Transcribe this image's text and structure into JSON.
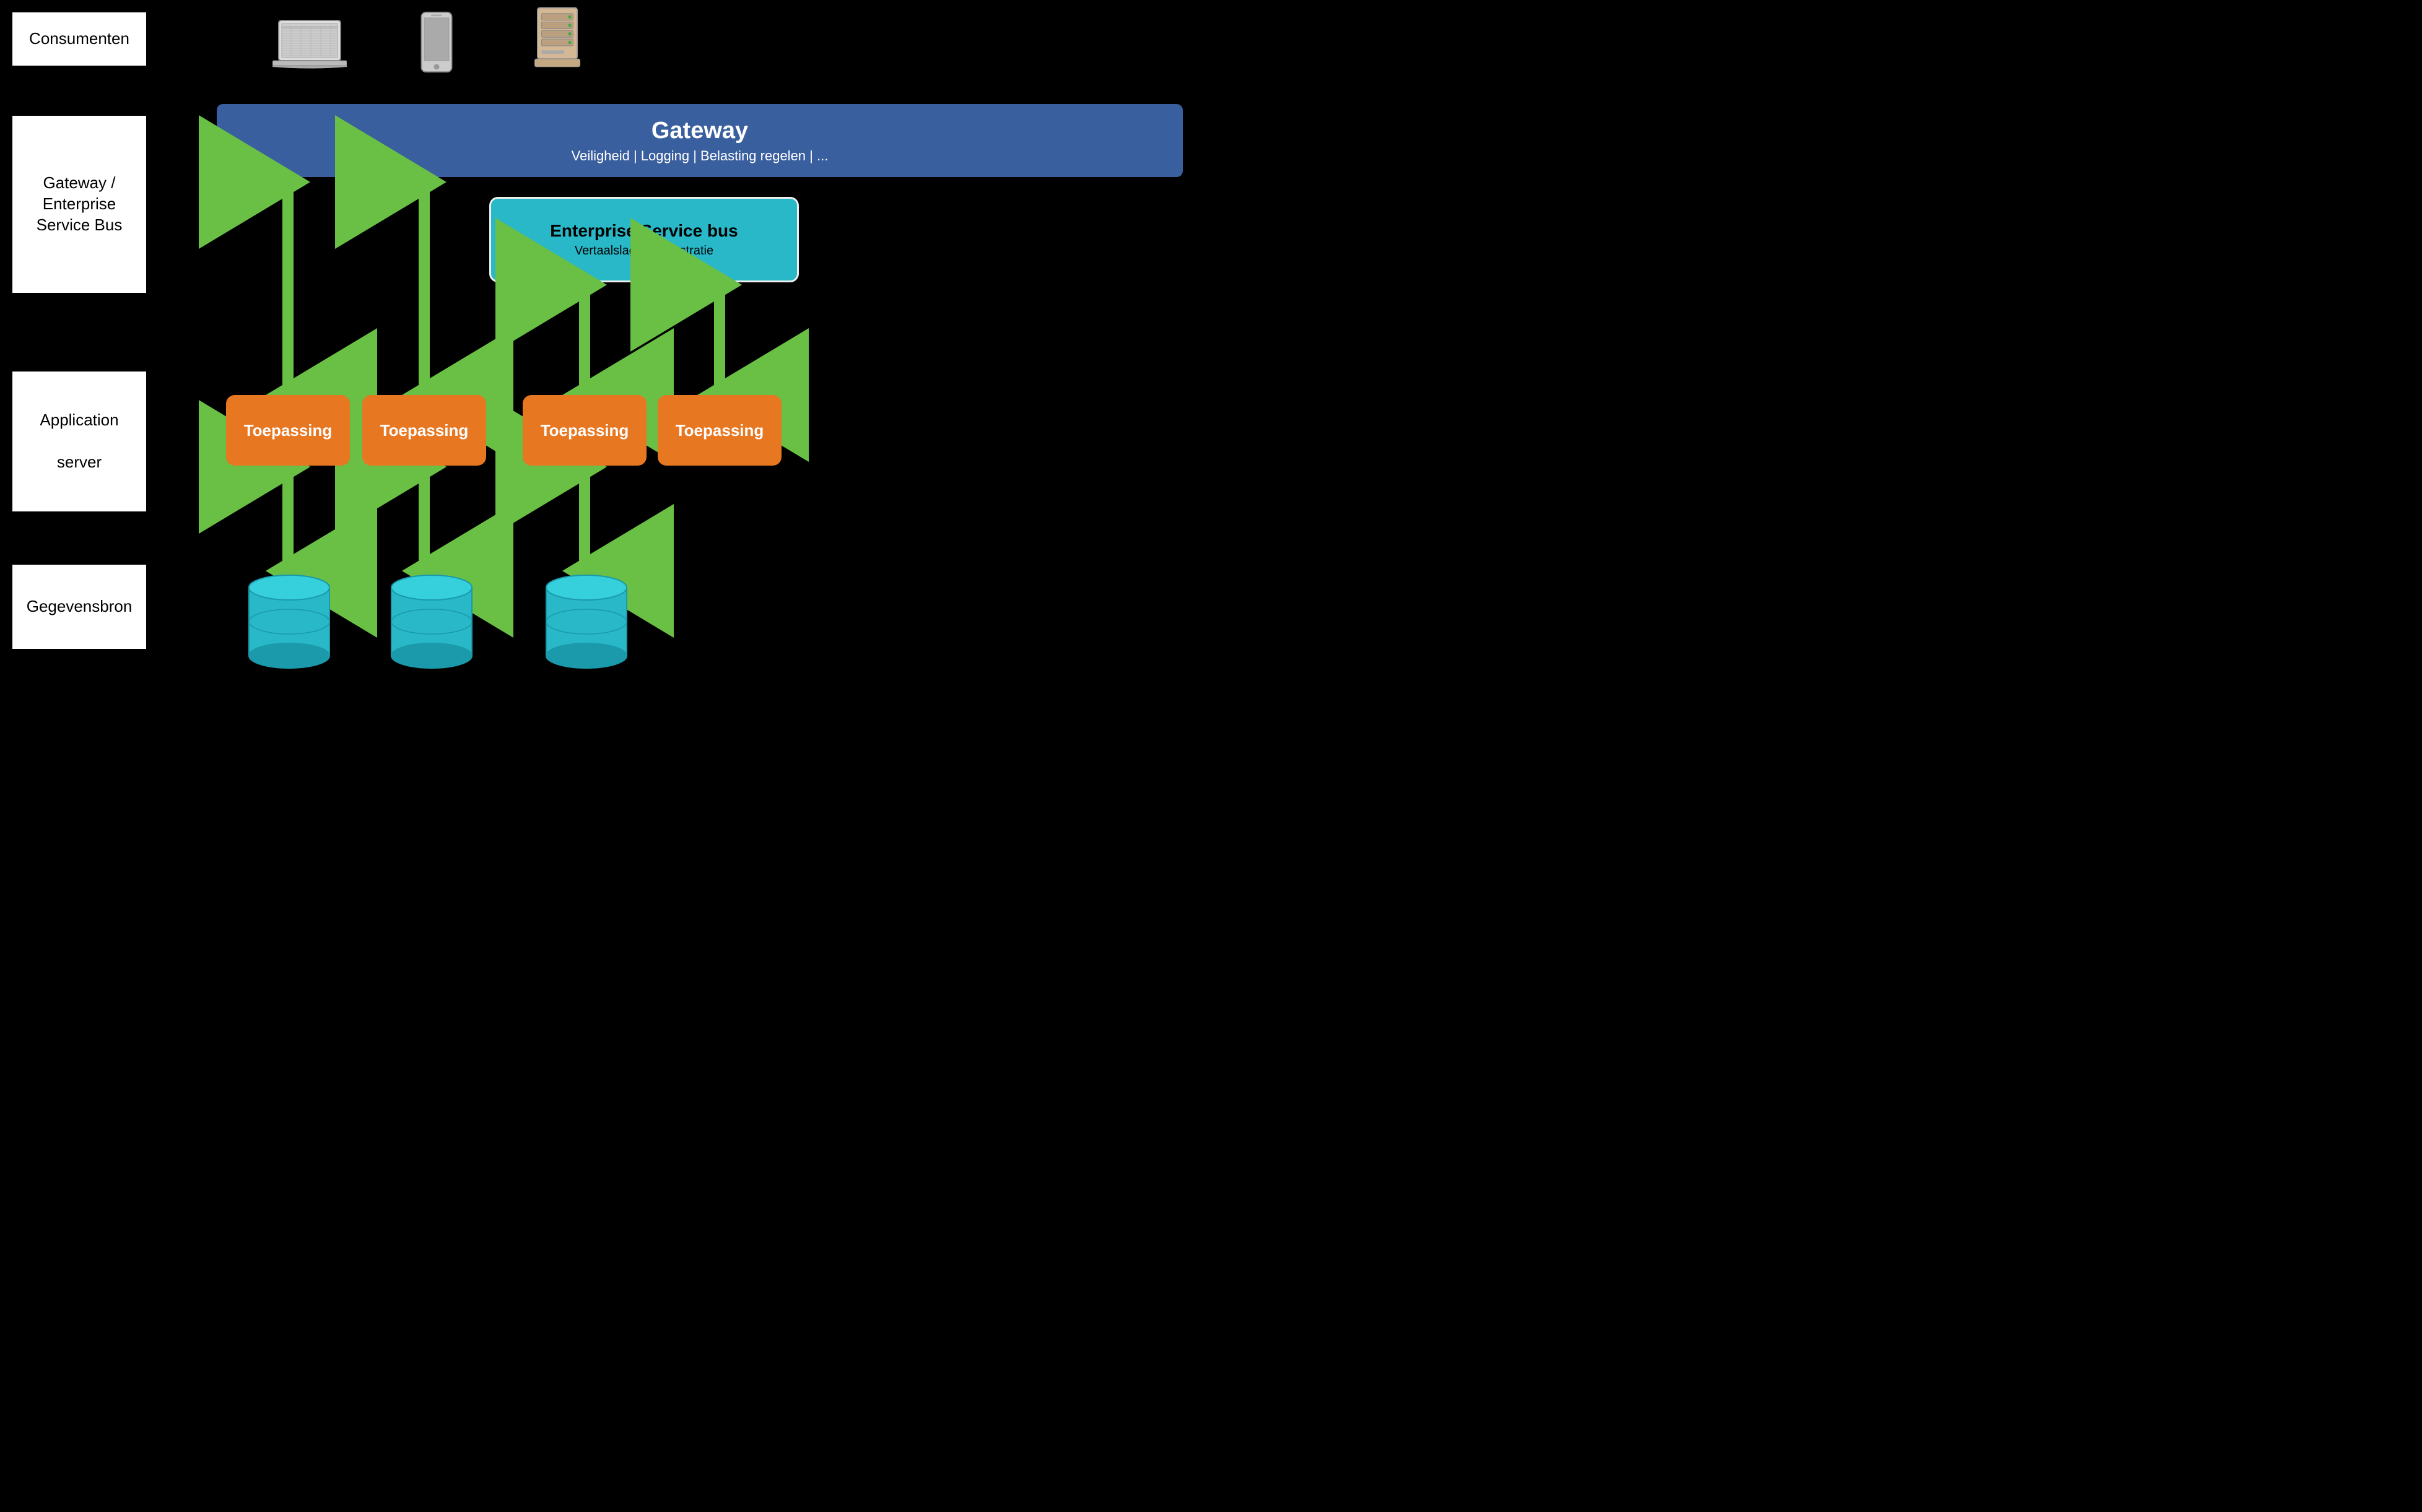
{
  "labels": {
    "consumenten": "Consumenten",
    "gateway_esb": "Gateway /\nEnterprise\nService Bus",
    "application_server": "Application\nserver",
    "gegevensbron": "Gegevensbron"
  },
  "consumers": [
    {
      "id": "browser",
      "label": "BROWSER"
    },
    {
      "id": "mobile",
      "label": "MOBILE"
    },
    {
      "id": "b2b",
      "label": "B2B"
    }
  ],
  "gateway": {
    "title": "Gateway",
    "subtitle": "Veiligheid | Logging | Belasting regelen | ..."
  },
  "esb": {
    "title": "Enterprise Service bus",
    "subtitle": "Vertaalslag | Orchestratie"
  },
  "applications": [
    {
      "label": "Toepassing"
    },
    {
      "label": "Toepassing"
    },
    {
      "label": "Toepassing"
    },
    {
      "label": "Toepassing"
    }
  ],
  "colors": {
    "background": "#000000",
    "gateway_blue": "#3a5f9e",
    "esb_cyan": "#29b8c8",
    "toepassing_orange": "#e87722",
    "arrow_green": "#6abf45",
    "db_cyan": "#29b8c8",
    "label_box_bg": "#ffffff"
  }
}
